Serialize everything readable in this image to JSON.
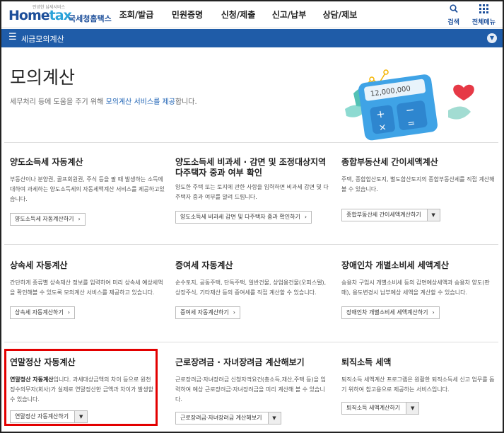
{
  "header": {
    "logo_tag": "안녕한 납세서비스",
    "logo_text_a": "Home",
    "logo_text_b": "tax",
    "logo_korname": "국세청홈택스",
    "menu": [
      "조회/발급",
      "민원증명",
      "신청/제출",
      "신고/납부",
      "상담/제보"
    ],
    "search_label": "검색",
    "allmenu_label": "전체메뉴"
  },
  "subbar": {
    "title": "세금모의계산"
  },
  "hero": {
    "title": "모의계산",
    "desc_before": "세무처리 등에 도움을 주기 위해 ",
    "desc_link": "모의계산 서비스를 제공",
    "desc_after": "합니다.",
    "calc_value": "12,000,000"
  },
  "cards": [
    {
      "title": "양도소득세 자동계산",
      "desc": "부동산이나 분양권, 골프회원권, 주식 등을 팔 때 발생하는 소득에 대하여 과세하는 양도소득세의 자동세액계산 서비스를 제공하고있습니다.",
      "button": "양도소득세 자동계산하기"
    },
    {
      "title": "양도소득세 비과세 · 감면 및 조정대상지역 다주택자 중과 여부 확인",
      "desc": "양도한 주택 또는 토지에 관한 사항을 입력하면 비과세 감면 및 다주택자 중과 여부를 알려 드립니다.",
      "button": "양도소득세 비과세 감면 및 다주택자 중과 확인하기"
    },
    {
      "title": "종합부동산세 간이세액계산",
      "desc": "주택, 종합합산토지, 별도합산토지의 종합부동산세를 직접 계산해 볼 수 있습니다.",
      "button": "종합부동산세 간이세액계산하기"
    },
    {
      "title": "상속세 자동계산",
      "desc": "간단하게 종류별 상속재산 정보를 입력하여 미리 상속세 예상세액을 확인해볼 수 있도록 모의계산 서비스를 제공하고 있습니다.",
      "button": "상속세 자동계산하기"
    },
    {
      "title": "증여세 자동계산",
      "desc": "순수토지, 공동주택, 단독주택, 일반건물, 상업용건물(오피스텔), 상장주식, 기타재산 등의 증여세를 직접 계산할 수 있습니다.",
      "button": "증여세 자동계산하기"
    },
    {
      "title": "장애인차 개별소비세 세액계산",
      "desc": "승용차 구입시 개별소비세 등의 감면예상세액과 승용차 양도(판매), 용도변경시 납부예상 세액을 계산할 수 있습니다.",
      "button": "장애인차 개별소비세 세액계산하기"
    },
    {
      "title": "연말정산 자동계산",
      "desc_bold": "연말정산 자동계산",
      "desc": "입니다. 과세대상금액의 차이 등으로 원천징수의무자(회사)가 실제로 연말정산한 금액과 차이가 발생할 수 있습니다.",
      "button": "연말정산 자동계산하기"
    },
    {
      "title": "근로장려금 · 자녀장려금 계산해보기",
      "desc": "근로장려금·자녀장려금 신청자격요건(총소득,재산,주택 등)을 입력하여 예상 근로장려금·자녀장려금을 미리 계산해 볼 수 있습니다.",
      "button": "근로장려금·자녀장려금 계산해보기"
    },
    {
      "title": "퇴직소득 세액",
      "desc": "퇴직소득 세액계산 프로그램은 원활한 퇴직소득세 신고 업무를 돕기 위하여 참고용으로 제공하는 서비스입니다.",
      "button": "퇴직소득 세액계산하기"
    }
  ],
  "colors": {
    "brand_blue": "#1f5ca8",
    "highlight_red": "#e30000",
    "link": "#1d62b4"
  }
}
